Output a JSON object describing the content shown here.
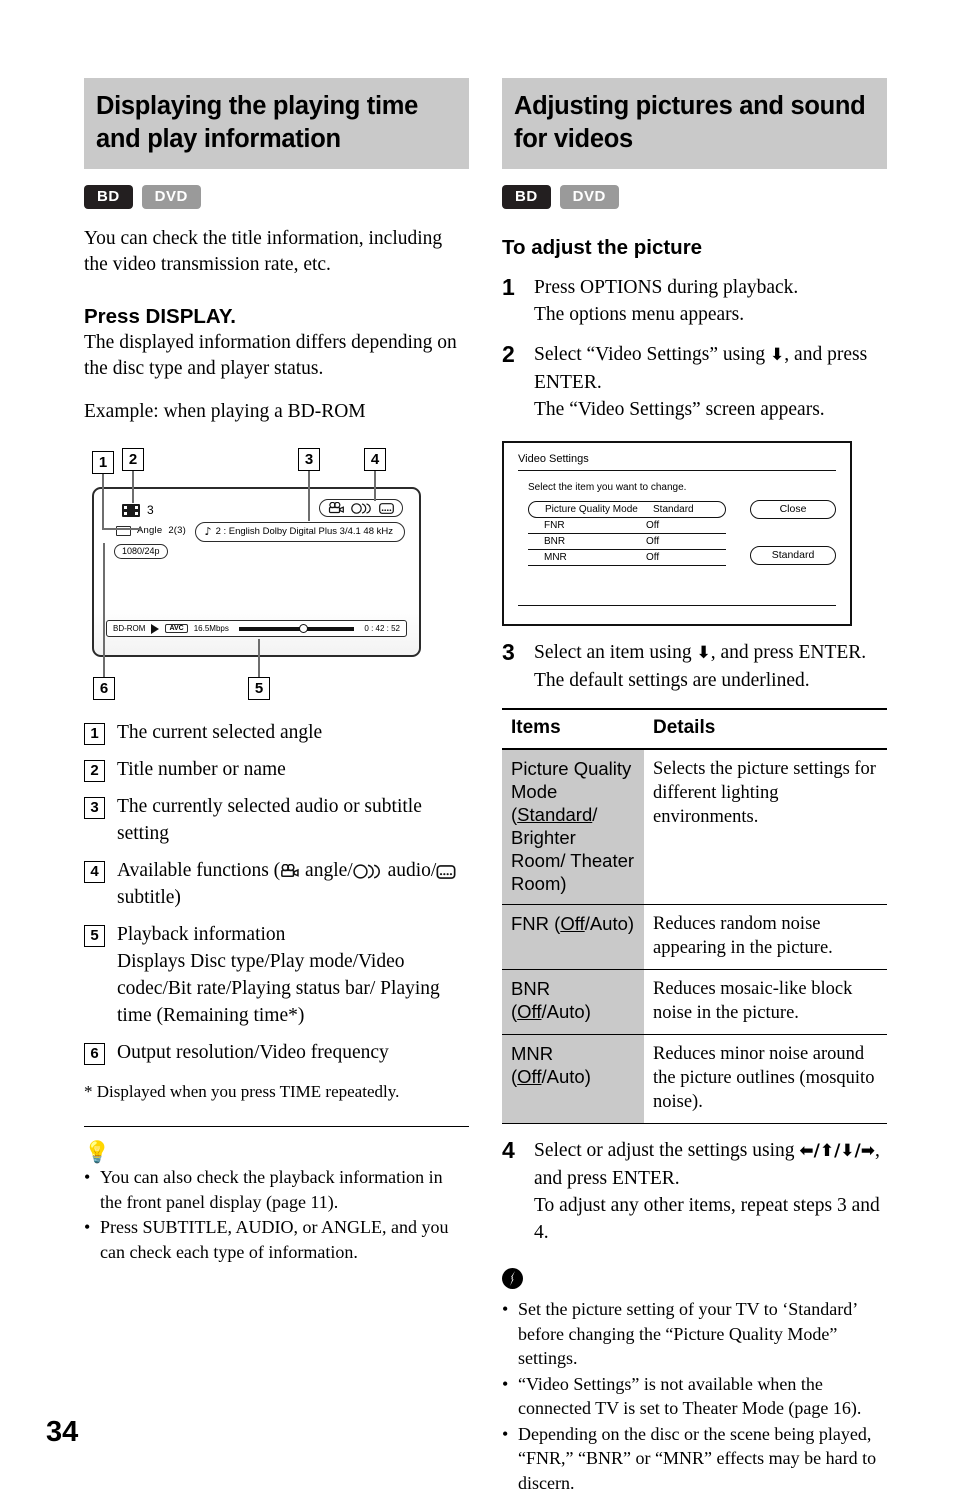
{
  "page": {
    "number": "34"
  },
  "left": {
    "heading": "Displaying the playing time and play information",
    "badges": [
      {
        "label": "BD",
        "color": "#231f20"
      },
      {
        "label": "DVD",
        "color": "#9a9a9a"
      }
    ],
    "intro": "You can check the title information, including the video transmission rate, etc.",
    "press_display_heading": "Press DISPLAY.",
    "press_display_body": "The displayed information differs depending on the disc type and player status.",
    "example_caption": "Example: when playing a BD-ROM",
    "osd": {
      "title_number": "3",
      "angle_label": "Angle",
      "angle_value": "2(3)",
      "resolution": "1080/24p",
      "audio_line": "2 : English  Dolby Digital Plus  3/4.1 48 kHz",
      "disc_type": "BD-ROM",
      "video_codec": "AVC",
      "bit_rate": "16.5Mbps",
      "time": "0 : 42 : 52",
      "callouts": [
        "1",
        "2",
        "3",
        "4",
        "5",
        "6"
      ]
    },
    "callout_list": [
      {
        "num": "1",
        "text": "The current selected angle"
      },
      {
        "num": "2",
        "text": "Title number or name"
      },
      {
        "num": "3",
        "text": "The currently selected audio or subtitle setting"
      },
      {
        "num": "4",
        "text": "Available functions (  angle/  audio/  subtitle)"
      },
      {
        "num": "5",
        "text": "Playback information Displays Disc type/Play mode/Video codec/Bit rate/Playing status bar/ Playing time (Remaining time*)"
      },
      {
        "num": "6",
        "text": "Output resolution/Video frequency"
      }
    ],
    "callout_4_parts": {
      "pre": "Available functions (",
      "mid1": " angle/",
      "mid2": " audio/",
      "post": " subtitle)"
    },
    "callout_5_line1": "Playback information",
    "callout_5_line2": "Displays Disc type/Play mode/Video codec/Bit rate/Playing status bar/ Playing time (Remaining time*)",
    "footnote": "* Displayed when you press TIME repeatedly.",
    "tip_icon": "tip-bulb-icon",
    "tips": [
      "You can also check the playback information in the front panel display (page 11).",
      "Press SUBTITLE, AUDIO, or ANGLE, and you can check each type of information."
    ]
  },
  "right": {
    "heading": "Adjusting pictures and sound for videos",
    "badges": [
      {
        "label": "BD",
        "color": "#231f20"
      },
      {
        "label": "DVD",
        "color": "#9a9a9a"
      }
    ],
    "sub_heading": "To adjust the picture",
    "steps": [
      {
        "num": "1",
        "lines": [
          "Press OPTIONS during playback.",
          "The options menu appears."
        ]
      },
      {
        "num": "2",
        "lines": [
          "Select “Video Settings” using ↑/↓, and press ENTER.",
          "The “Video Settings” screen appears."
        ]
      },
      {
        "num": "3",
        "lines": [
          "Select an item using ↑/↓, and press ENTER.",
          "The default settings are underlined."
        ]
      },
      {
        "num": "4",
        "lines": [
          "Select or adjust the settings using ←/↑/↓/→, and press ENTER.",
          "To adjust any other items, repeat steps 3 and 4."
        ]
      }
    ],
    "step2_text_a": "Select “Video Settings” using ",
    "step2_text_b": ", and press ENTER.",
    "step2_text_c": "The “Video Settings” screen appears.",
    "step3_text_a": "Select an item using ",
    "step3_text_b": ", and press ENTER.",
    "step3_text_c": "The default settings are underlined.",
    "step4_text_a": "Select or adjust the settings using ",
    "step4_text_b": ", and press ENTER.",
    "step4_text_c": "To adjust any other items, repeat steps 3 and 4.",
    "video_settings_screen": {
      "title": "Video Settings",
      "subtitle": "Select the item you want to change.",
      "rows": [
        {
          "label": "Picture Quality Mode",
          "value": "Standard",
          "selected": true
        },
        {
          "label": "FNR",
          "value": "Off",
          "selected": false
        },
        {
          "label": "BNR",
          "value": "Off",
          "selected": false
        },
        {
          "label": "MNR",
          "value": "Off",
          "selected": false
        }
      ],
      "buttons": [
        "Close",
        "Standard"
      ]
    },
    "table": {
      "headers": [
        "Items",
        "Details"
      ],
      "rows": [
        {
          "item_name": "Picture Quality Mode",
          "item_options_pre": "(",
          "item_options_default": "Standard",
          "item_options_rest": "/ Brighter Room/ Theater Room)",
          "details": "Selects the picture settings for different lighting environments."
        },
        {
          "item_name": "FNR",
          "item_options_pre": "(",
          "item_options_default": "Off",
          "item_options_rest": "/Auto)",
          "details": "Reduces random noise appearing in the picture."
        },
        {
          "item_name": "BNR",
          "item_options_pre": "(",
          "item_options_default": "Off",
          "item_options_rest": "/Auto)",
          "details": "Reduces mosaic-like block noise in the picture."
        },
        {
          "item_name": "MNR",
          "item_options_pre": "(",
          "item_options_default": "Off",
          "item_options_rest": "/Auto)",
          "details": "Reduces minor noise around the picture outlines (mosquito noise)."
        }
      ]
    },
    "note_icon": "note-warning-icon",
    "notes": [
      "Set the picture setting of your TV to ‘Standard’ before changing the “Picture Quality Mode” settings.",
      "“Video Settings” is not available when the connected TV is set to Theater Mode (page 16).",
      "Depending on the disc or the scene being played, “FNR,” “BNR” or “MNR” effects may be hard to discern."
    ]
  }
}
